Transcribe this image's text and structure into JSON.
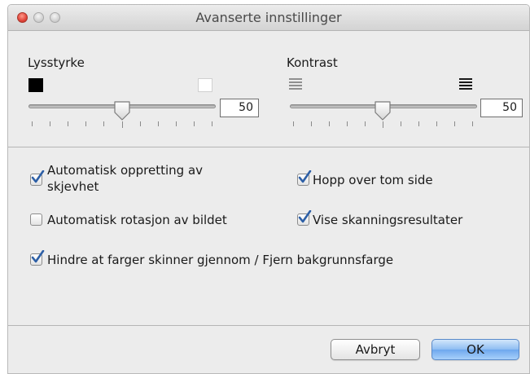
{
  "window": {
    "title": "Avanserte innstillinger"
  },
  "brightness": {
    "label": "Lysstyrke",
    "value": "50",
    "slider_fraction": 0.5,
    "icons": [
      "black-square-icon",
      "white-square-icon"
    ]
  },
  "contrast": {
    "label": "Kontrast",
    "value": "50",
    "slider_fraction": 0.5,
    "icons": [
      "low-contrast-icon",
      "high-contrast-icon"
    ]
  },
  "options": {
    "auto_deskew": {
      "label_line1": "Automatisk oppretting av",
      "label_line2": "skjevhet",
      "checked": true
    },
    "skip_blank": {
      "label": "Hopp over tom side",
      "checked": true
    },
    "auto_rotate": {
      "label": "Automatisk rotasjon av bildet",
      "checked": false
    },
    "show_results": {
      "label": "Vise skanningsresultater",
      "checked": true
    },
    "bleed_through": {
      "label": "Hindre at farger skinner gjennom / Fjern bakgrunnsfarge",
      "checked": true
    }
  },
  "buttons": {
    "cancel": "Avbryt",
    "ok": "OK"
  },
  "colors": {
    "check": "#2d5fa6",
    "default_button": "#7db1f0"
  }
}
